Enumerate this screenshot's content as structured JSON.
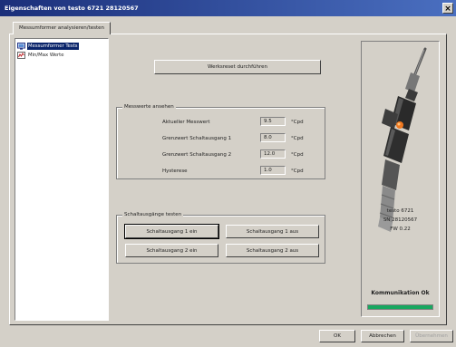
{
  "window": {
    "title": "Eigenschaften von testo 6721  28120567",
    "close_glyph": "×"
  },
  "tabs": [
    {
      "label": "Messumformer analysieren/testen"
    }
  ],
  "tree": {
    "items": [
      {
        "label": "Messumformer Tests",
        "icon": "monitor-icon",
        "selected": true
      },
      {
        "label": "Min/Max Werte",
        "icon": "chart-icon",
        "selected": false
      }
    ]
  },
  "main": {
    "reset_button": "Werksreset durchführen",
    "measurements": {
      "title": "Messwerte ansehen",
      "rows": [
        {
          "label": "Aktueller Messwert",
          "value": "9.5",
          "unit": "°Cpd"
        },
        {
          "label": "Grenzwert Schaltausgang 1",
          "value": "8.0",
          "unit": "°Cpd"
        },
        {
          "label": "Grenzwert Schaltausgang 2",
          "value": "12.0",
          "unit": "°Cpd"
        },
        {
          "label": "Hysterese",
          "value": "1.0",
          "unit": "°Cpd"
        }
      ]
    },
    "switch_test": {
      "title": "Schaltausgänge testen",
      "buttons": [
        "Schaltausgang 1 ein",
        "Schaltausgang 1 aus",
        "Schaltausgang 2 ein",
        "Schaltausgang 2 aus"
      ]
    }
  },
  "device": {
    "model": "testo 6721",
    "serial": "SN 28120567",
    "firmware": "FW 0.22",
    "connection_status": "Kommunikation Ok",
    "connection_color": "#18a860"
  },
  "footer": {
    "ok": "OK",
    "cancel": "Abbrechen",
    "apply": "Übernehmen"
  }
}
